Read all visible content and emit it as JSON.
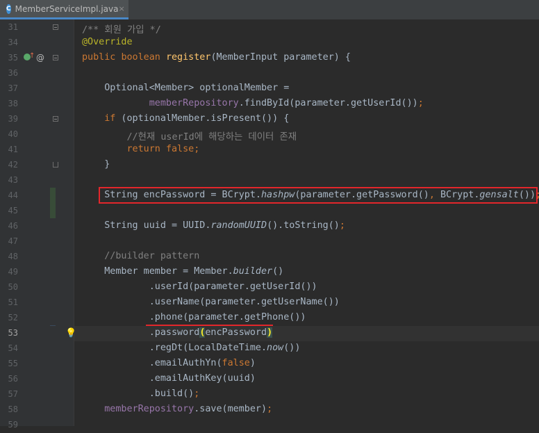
{
  "tab": {
    "filename": "MemberServiceImpl.java",
    "icon_letter": "C",
    "close": "×"
  },
  "lines": [
    {
      "n": "31",
      "code": "/** 회원 가입 */"
    },
    {
      "n": "34",
      "code": "@Override"
    },
    {
      "n": "35",
      "code": "public boolean register(MemberInput parameter) {"
    },
    {
      "n": "36",
      "code": ""
    },
    {
      "n": "37",
      "code": "    Optional<Member> optionalMember ="
    },
    {
      "n": "38",
      "code": "            memberRepository.findById(parameter.getUserId());"
    },
    {
      "n": "39",
      "code": "    if (optionalMember.isPresent()) {"
    },
    {
      "n": "40",
      "code": "        //현재 userId에 해당하는 데이터 존재"
    },
    {
      "n": "41",
      "code": "        return false;"
    },
    {
      "n": "42",
      "code": "    }"
    },
    {
      "n": "43",
      "code": ""
    },
    {
      "n": "44",
      "code": "    String encPassword = BCrypt.hashpw(parameter.getPassword(), BCrypt.gensalt());"
    },
    {
      "n": "45",
      "code": ""
    },
    {
      "n": "46",
      "code": "    String uuid = UUID.randomUUID().toString();"
    },
    {
      "n": "47",
      "code": ""
    },
    {
      "n": "48",
      "code": "    //builder pattern"
    },
    {
      "n": "49",
      "code": "    Member member = Member.builder()"
    },
    {
      "n": "50",
      "code": "            .userId(parameter.getUserId())"
    },
    {
      "n": "51",
      "code": "            .userName(parameter.getUserName())"
    },
    {
      "n": "52",
      "code": "            .phone(parameter.getPhone())"
    },
    {
      "n": "53",
      "code": "            .password(encPassword)"
    },
    {
      "n": "54",
      "code": "            .regDt(LocalDateTime.now())"
    },
    {
      "n": "55",
      "code": "            .emailAuthYn(false)"
    },
    {
      "n": "56",
      "code": "            .emailAuthKey(uuid)"
    },
    {
      "n": "57",
      "code": "            .build();"
    },
    {
      "n": "58",
      "code": "    memberRepository.save(member);"
    },
    {
      "n": "59",
      "code": ""
    }
  ],
  "colors": {
    "keyword": "#cc7832",
    "annotation": "#bbb529",
    "method_decl": "#ffc66d",
    "field": "#9876aa",
    "comment": "#808080",
    "default": "#a9b7c6",
    "highlight_box": "#e3262b"
  },
  "gutter_icons": {
    "line35": [
      "override-icon",
      "annotation-at-icon"
    ],
    "line53": [
      "lightbulb-icon"
    ]
  }
}
